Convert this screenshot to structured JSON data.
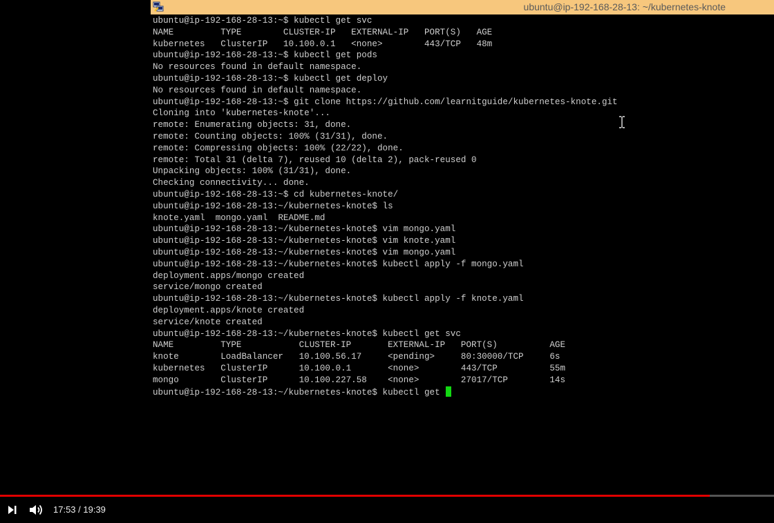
{
  "window": {
    "title": "ubuntu@ip-192-168-28-13: ~/kubernetes-knote",
    "icon": "putty-icon",
    "titlebar_color": "#f7c77d"
  },
  "terminal": {
    "text_color": "#cfcfcf",
    "cursor_color": "#12d812",
    "lines": [
      "ubuntu@ip-192-168-28-13:~$ kubectl get svc",
      "NAME         TYPE        CLUSTER-IP   EXTERNAL-IP   PORT(S)   AGE",
      "kubernetes   ClusterIP   10.100.0.1   <none>        443/TCP   48m",
      "ubuntu@ip-192-168-28-13:~$ kubectl get pods",
      "No resources found in default namespace.",
      "ubuntu@ip-192-168-28-13:~$ kubectl get deploy",
      "No resources found in default namespace.",
      "ubuntu@ip-192-168-28-13:~$ git clone https://github.com/learnitguide/kubernetes-knote.git",
      "Cloning into 'kubernetes-knote'...",
      "remote: Enumerating objects: 31, done.",
      "remote: Counting objects: 100% (31/31), done.",
      "remote: Compressing objects: 100% (22/22), done.",
      "remote: Total 31 (delta 7), reused 10 (delta 2), pack-reused 0",
      "Unpacking objects: 100% (31/31), done.",
      "Checking connectivity... done.",
      "ubuntu@ip-192-168-28-13:~$ cd kubernetes-knote/",
      "ubuntu@ip-192-168-28-13:~/kubernetes-knote$ ls",
      "knote.yaml  mongo.yaml  README.md",
      "ubuntu@ip-192-168-28-13:~/kubernetes-knote$ vim mongo.yaml",
      "ubuntu@ip-192-168-28-13:~/kubernetes-knote$ vim knote.yaml",
      "ubuntu@ip-192-168-28-13:~/kubernetes-knote$ vim mongo.yaml",
      "ubuntu@ip-192-168-28-13:~/kubernetes-knote$ kubectl apply -f mongo.yaml",
      "deployment.apps/mongo created",
      "service/mongo created",
      "ubuntu@ip-192-168-28-13:~/kubernetes-knote$ kubectl apply -f knote.yaml",
      "deployment.apps/knote created",
      "service/knote created",
      "ubuntu@ip-192-168-28-13:~/kubernetes-knote$ kubectl get svc",
      "NAME         TYPE           CLUSTER-IP       EXTERNAL-IP   PORT(S)          AGE",
      "knote        LoadBalancer   10.100.56.17     <pending>     80:30000/TCP     6s",
      "kubernetes   ClusterIP      10.100.0.1       <none>        443/TCP          55m",
      "mongo        ClusterIP      10.100.227.58    <none>        27017/TCP        14s"
    ],
    "prompt_line": "ubuntu@ip-192-168-28-13:~/kubernetes-knote$ kubectl get "
  },
  "player": {
    "progress_fraction": 0.917,
    "progress_color": "#e00000",
    "time_current": "17:53",
    "time_total": "19:39",
    "time_display": "17:53 / 19:39",
    "next_icon": "skip-next-icon",
    "volume_icon": "volume-icon"
  }
}
